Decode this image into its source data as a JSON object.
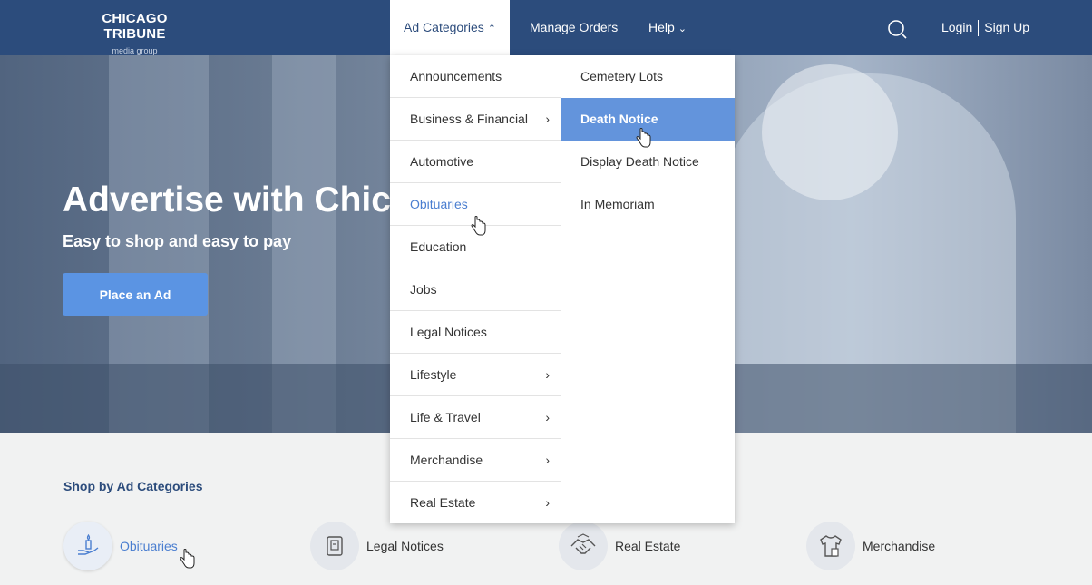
{
  "header": {
    "logo_main": "CHICAGO TRIBUNE",
    "logo_sub": "media group",
    "nav": {
      "ad_categories": "Ad Categories",
      "manage_orders": "Manage Orders",
      "help": "Help"
    },
    "login": "Login",
    "signup": "Sign Up"
  },
  "hero": {
    "title": "Advertise with Chic",
    "subtitle": "Easy to shop and easy to pay",
    "cta": "Place an Ad"
  },
  "dropdown": {
    "left": [
      {
        "label": "Announcements",
        "chevron": ""
      },
      {
        "label": "Business & Financial",
        "chevron": "›"
      },
      {
        "label": "Automotive",
        "chevron": ""
      },
      {
        "label": "Obituaries",
        "chevron": ""
      },
      {
        "label": "Education",
        "chevron": ""
      },
      {
        "label": "Jobs",
        "chevron": ""
      },
      {
        "label": "Legal Notices",
        "chevron": ""
      },
      {
        "label": "Lifestyle",
        "chevron": "›"
      },
      {
        "label": "Life & Travel",
        "chevron": "›"
      },
      {
        "label": "Merchandise",
        "chevron": "›"
      },
      {
        "label": "Real Estate",
        "chevron": "›"
      }
    ],
    "right": [
      {
        "label": "Cemetery Lots"
      },
      {
        "label": "Death Notice"
      },
      {
        "label": "Display Death Notice"
      },
      {
        "label": "In Memoriam"
      }
    ]
  },
  "shop": {
    "title": "Shop by Ad Categories",
    "categories": [
      {
        "label": "Obituaries",
        "icon": "hand-candle-icon"
      },
      {
        "label": "Legal Notices",
        "icon": "document-icon"
      },
      {
        "label": "Real Estate",
        "icon": "handshake-icon"
      },
      {
        "label": "Merchandise",
        "icon": "shirt-icon"
      }
    ]
  },
  "colors": {
    "header_bg": "#2c4c7c",
    "accent": "#5b94e3",
    "highlight": "#6394dc"
  }
}
